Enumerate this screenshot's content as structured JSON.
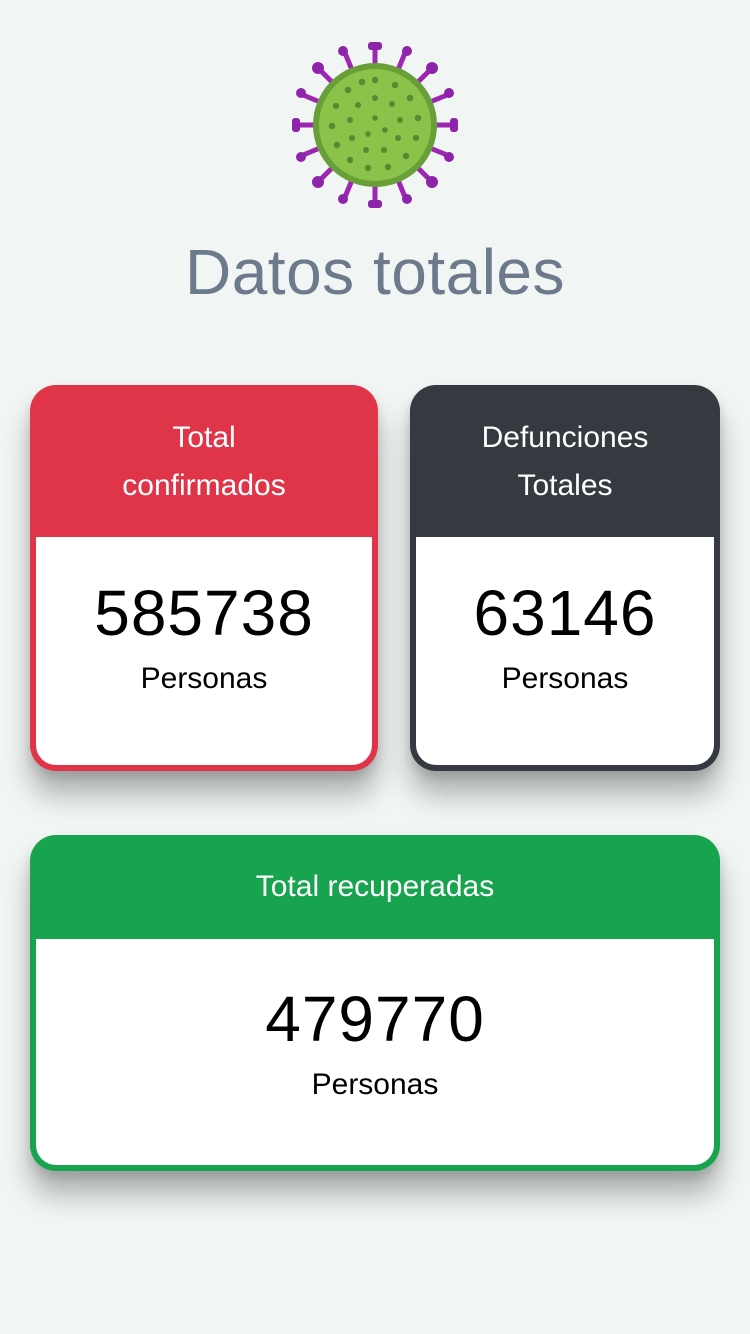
{
  "header": {
    "icon": "virus-icon",
    "title": "Datos totales"
  },
  "cards": {
    "confirmed": {
      "title_line1": "Total",
      "title_line2": "confirmados",
      "value": "585738",
      "unit": "Personas",
      "color": "#e03548"
    },
    "deaths": {
      "title_line1": "Defunciones",
      "title_line2": "Totales",
      "value": "63146",
      "unit": "Personas",
      "color": "#353a41"
    },
    "recovered": {
      "title": "Total recuperadas",
      "value": "479770",
      "unit": "Personas",
      "color": "#18a44f"
    }
  },
  "colors": {
    "background": "#f1f5f4",
    "title": "#6c7a8b",
    "virus_body": "#8bc34a",
    "virus_spikes": "#8e24aa"
  }
}
